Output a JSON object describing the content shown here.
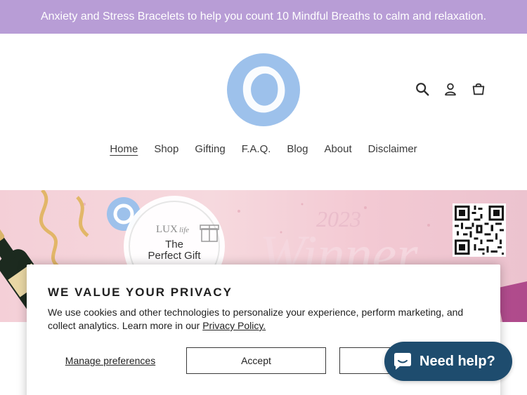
{
  "announcement": "Anxiety and Stress Bracelets to help you count 10 Mindful Breaths to calm and relaxation.",
  "colors": {
    "announcement_bg": "#b89dd6",
    "logo_blue": "#9dc1eb",
    "chat_bg": "#1e4c6e",
    "banner_pink": "#f4cfd7"
  },
  "header": {
    "icons": [
      "search-icon",
      "account-icon",
      "cart-icon"
    ]
  },
  "nav": {
    "items": [
      "Home",
      "Shop",
      "Gifting",
      "F.A.Q.",
      "Blog",
      "About",
      "Disclaimer"
    ],
    "active": "Home"
  },
  "banner": {
    "award_brand": "LUX",
    "award_brand_script": "life",
    "award_line1": "The",
    "award_line2": "Perfect Gift",
    "year": "2023",
    "headline": "Winner"
  },
  "privacy": {
    "title": "WE VALUE YOUR PRIVACY",
    "text": "We use cookies and other technologies to personalize your experience, perform marketing, and collect analytics. Learn more in our",
    "link": "Privacy Policy.",
    "manage": "Manage preferences",
    "accept": "Accept",
    "decline": ""
  },
  "chat": {
    "label": "Need help?"
  }
}
